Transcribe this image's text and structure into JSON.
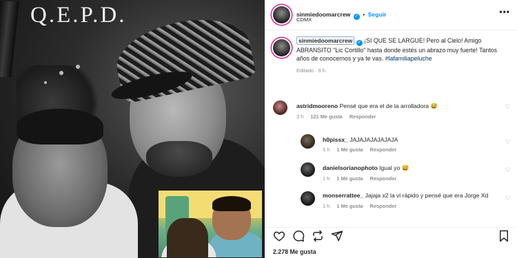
{
  "photo": {
    "overlay_text": "Q.E.P.D."
  },
  "post": {
    "author": "sinmiedoomarcrew",
    "follow_label": "Seguir",
    "location": "CDMX",
    "more_label": "•••",
    "caption_author": "sinmiedoomarcrew",
    "caption_text": "¡SI QUE SE LARGUE! Pero al Cielo! Amigo ABRANSITO \"Lic Cortillo\" hasta donde estés un abrazo muy fuerte! Tantos años de conocernos y ya te vas.",
    "hashtag": "#lafamiliapeluche",
    "edited": "Editado · 9 h"
  },
  "comments": [
    {
      "user": "astridmooreno",
      "text": "Pensé que era el de la arrolladora 😅",
      "time": "3 h",
      "likes": "121 Me gusta",
      "reply": "Responder"
    },
    {
      "user": "h0pissx_",
      "text": "JAJAJAJAJAJAJA",
      "time": "3 h",
      "likes": "1 Me gusta",
      "reply": "Responder"
    },
    {
      "user": "danielsorianophoto",
      "text": "Igual yo 😅",
      "time": "1 h",
      "likes": "1 Me gusta",
      "reply": "Responder"
    },
    {
      "user": "monserrattee_",
      "text": "Jajaja x2 la vi rápido y pensé que era Jorge Xd",
      "time": "1 h",
      "likes": "1 Me gusta",
      "reply": "Responder"
    }
  ],
  "actions": {
    "like_icon": "heart-icon",
    "comment_icon": "comment-icon",
    "share_icon": "repost-icon",
    "send_icon": "send-icon",
    "save_icon": "bookmark-icon"
  },
  "likes_count": "2.278 Me gusta",
  "colors": {
    "link_blue": "#0095f6",
    "hashtag_blue": "#00376b",
    "muted": "#8e8e8e"
  }
}
